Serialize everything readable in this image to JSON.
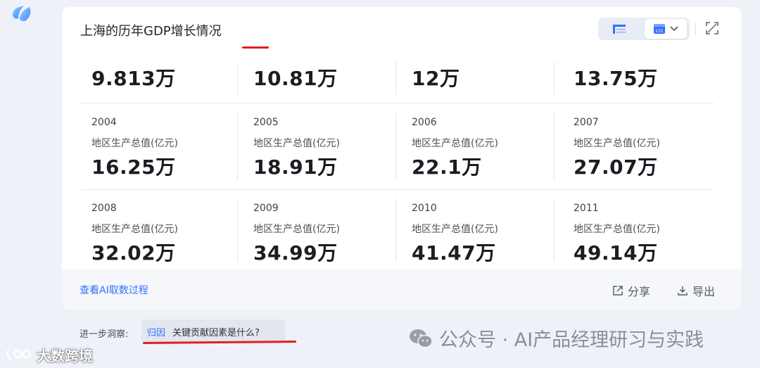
{
  "header": {
    "title": "上海的历年GDP增长情况"
  },
  "toolbar": {
    "view_table_icon": "table-view-icon",
    "view_chart_icon": "chart-view-icon",
    "dropdown_icon": "chevron-down-icon",
    "expand_icon": "expand-icon"
  },
  "top_row": {
    "values": [
      "9.813万",
      "10.81万",
      "12万",
      "13.75万"
    ]
  },
  "rows": [
    {
      "cells": [
        {
          "year": "2004",
          "label": "地区生产总值(亿元)",
          "value": "16.25万"
        },
        {
          "year": "2005",
          "label": "地区生产总值(亿元)",
          "value": "18.91万"
        },
        {
          "year": "2006",
          "label": "地区生产总值(亿元)",
          "value": "22.1万"
        },
        {
          "year": "2007",
          "label": "地区生产总值(亿元)",
          "value": "27.07万"
        }
      ]
    },
    {
      "cells": [
        {
          "year": "2008",
          "label": "地区生产总值(亿元)",
          "value": "32.02万"
        },
        {
          "year": "2009",
          "label": "地区生产总值(亿元)",
          "value": "34.99万"
        },
        {
          "year": "2010",
          "label": "地区生产总值(亿元)",
          "value": "41.47万"
        },
        {
          "year": "2011",
          "label": "地区生产总值(亿元)",
          "value": "49.14万"
        }
      ]
    }
  ],
  "footer": {
    "process_link": "查看AI取数过程",
    "share_label": "分享",
    "export_label": "导出"
  },
  "insight": {
    "label": "进一步洞察:",
    "tag": "归因",
    "question": "关键贡献因素是什么?"
  },
  "watermarks": {
    "wechat": "公众号 · AI产品经理研习与实践",
    "corner": "大数跨境"
  },
  "colors": {
    "accent": "#3370ff",
    "annotation": "#e02020"
  }
}
